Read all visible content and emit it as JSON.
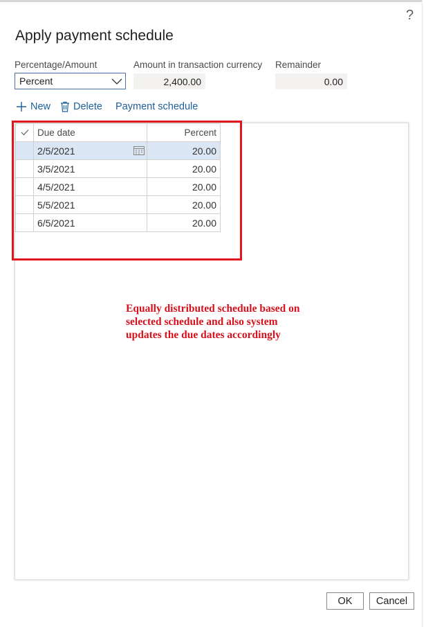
{
  "dialog": {
    "title": "Apply payment schedule",
    "help_icon": "?"
  },
  "fields": {
    "percentage_amount_label": "Percentage/Amount",
    "percentage_amount_value": "Percent",
    "amount_label": "Amount in transaction currency",
    "amount_value": "2,400.00",
    "remainder_label": "Remainder",
    "remainder_value": "0.00"
  },
  "toolbar": {
    "new_label": "New",
    "delete_label": "Delete",
    "payment_schedule_label": "Payment schedule"
  },
  "grid": {
    "headers": {
      "due_date": "Due date",
      "percent": "Percent"
    },
    "rows": [
      {
        "due_date": "2/5/2021",
        "percent": "20.00"
      },
      {
        "due_date": "3/5/2021",
        "percent": "20.00"
      },
      {
        "due_date": "4/5/2021",
        "percent": "20.00"
      },
      {
        "due_date": "5/5/2021",
        "percent": "20.00"
      },
      {
        "due_date": "6/5/2021",
        "percent": "20.00"
      }
    ]
  },
  "annotation": {
    "line1": "Equally distributed schedule based on",
    "line2": "selected schedule and also system",
    "line3": "updates the due dates accordingly",
    "color": "#d6111c"
  },
  "buttons": {
    "ok": "OK",
    "cancel": "Cancel"
  },
  "colors": {
    "link": "#1d5f9c",
    "selected_row": "#dbe6f5",
    "highlight_border": "#e0151e"
  }
}
